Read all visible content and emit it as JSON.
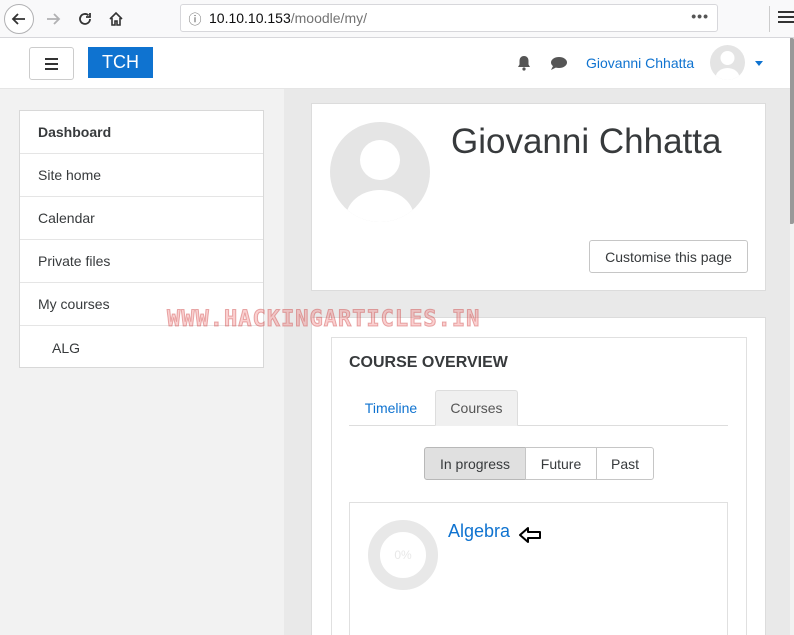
{
  "browser": {
    "url_host": "10.10.10.153",
    "url_path": "/moodle/my/",
    "page_actions": "•••"
  },
  "navbar": {
    "brand": "TCH",
    "user_name": "Giovanni Chhatta"
  },
  "sidebar": {
    "items": [
      {
        "label": "Dashboard"
      },
      {
        "label": "Site home"
      },
      {
        "label": "Calendar"
      },
      {
        "label": "Private files"
      },
      {
        "label": "My courses"
      },
      {
        "label": "ALG"
      }
    ]
  },
  "header": {
    "full_name": "Giovanni Chhatta",
    "customise_label": "Customise this page"
  },
  "watermark": "WWW.HACKINGARTICLES.IN",
  "course_overview": {
    "title": "COURSE OVERVIEW",
    "tabs": [
      {
        "label": "Timeline"
      },
      {
        "label": "Courses",
        "active": true
      }
    ],
    "filters": [
      {
        "label": "In progress",
        "active": true
      },
      {
        "label": "Future"
      },
      {
        "label": "Past"
      }
    ],
    "courses": [
      {
        "name": "Algebra",
        "progress_label": "0%",
        "progress": 0
      }
    ]
  },
  "colors": {
    "brand": "#0f73d0",
    "link": "#0f73d0"
  }
}
